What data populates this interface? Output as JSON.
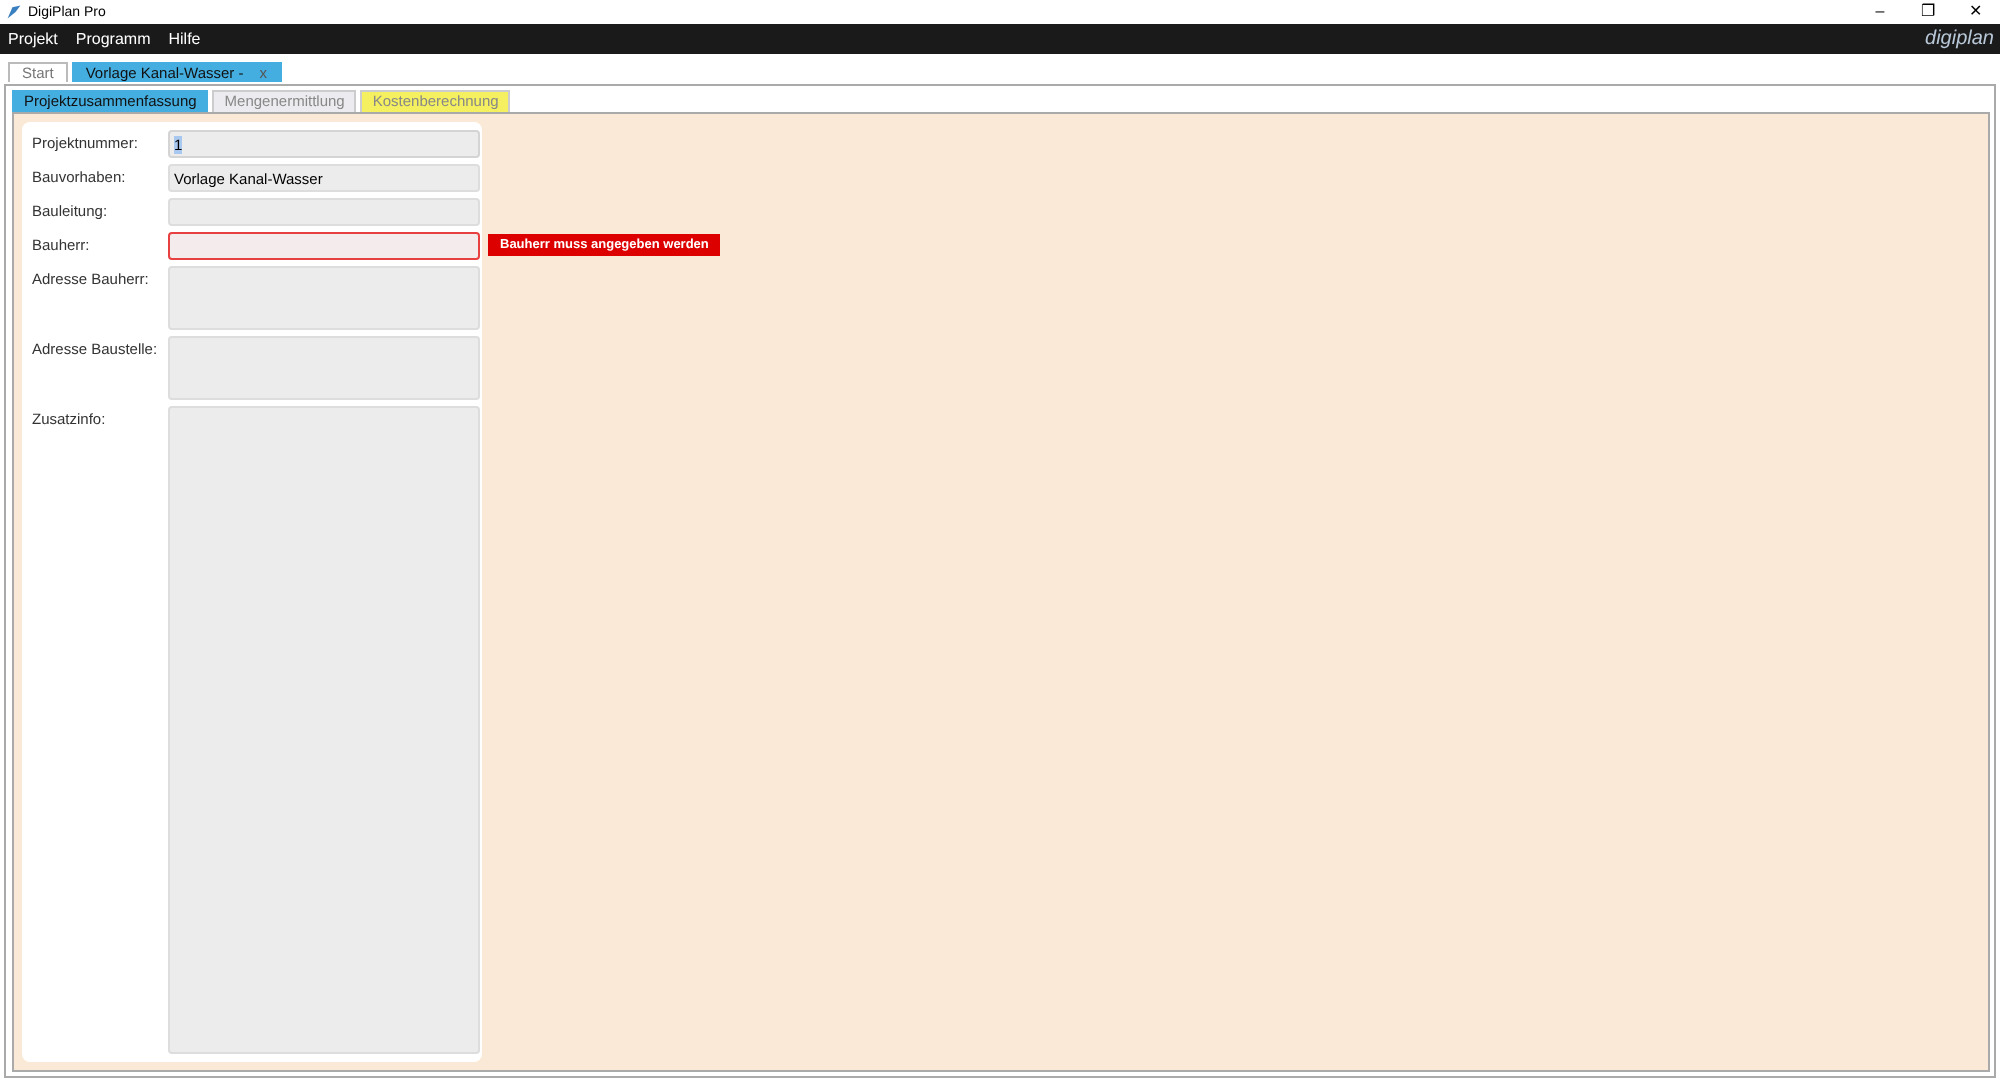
{
  "window": {
    "title": "DigiPlan Pro",
    "controls": [
      "–",
      "❐",
      "✕"
    ]
  },
  "menu": [
    "Projekt",
    "Programm",
    "Hilfe"
  ],
  "logo": {
    "text": "digiplan"
  },
  "doc_tabs": [
    {
      "label": "Start",
      "selected": false
    },
    {
      "label": "Vorlage Kanal-Wasser -",
      "selected": true,
      "close": "x"
    }
  ],
  "tabs": [
    {
      "label": "Projektzusammenfassung",
      "selected": true,
      "color": "#44aee0"
    },
    {
      "label": "Mengenermittlung",
      "selected": false,
      "color": "#ececf0"
    },
    {
      "label": "Kostenberechnung",
      "selected": false,
      "color": "#f5f060"
    }
  ],
  "fields": [
    {
      "label": "Projektnummer:",
      "kind": "line",
      "value": "1",
      "highlighted": true,
      "error": false
    },
    {
      "label": "Bauvorhaben:",
      "kind": "line",
      "value": "Vorlage Kanal-Wasser",
      "highlighted": false,
      "error": false
    },
    {
      "label": "Bauleitung:",
      "kind": "line",
      "error": false
    },
    {
      "label": "Bauherr:",
      "kind": "line",
      "error": true,
      "message": "Bauherr muss angegeben werden"
    },
    {
      "label": "Adresse Bauherr:",
      "kind": "area",
      "error": false
    },
    {
      "label": "Adresse Baustelle:",
      "kind": "area",
      "error": false
    },
    {
      "label": "Zusatzinfo:",
      "kind": "fill",
      "error": false
    }
  ]
}
